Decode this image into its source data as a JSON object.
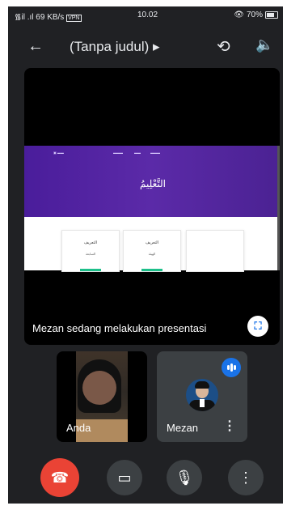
{
  "status_bar": {
    "signal": "᯾il .ıl 69 KB/s",
    "vpn": "VPN",
    "time": "10.02",
    "battery": "70%"
  },
  "toolbar": {
    "title": "(Tanpa judul) ▸"
  },
  "presentation": {
    "text": "Mezan sedang melakukan presentasi",
    "slide_arabic": "التَّعْلِيمُ",
    "cards": [
      {
        "t1": "التعريف",
        "t2": "السابعة"
      },
      {
        "t1": "التعريف",
        "t2": "الهيئة"
      }
    ]
  },
  "participants": {
    "self_name": "Anda",
    "other_name": "Mezan"
  },
  "colors": {
    "background": "#202124",
    "end_call": "#ea4335",
    "accent": "#1a73e8",
    "slide_purple": "#4a1d9b"
  }
}
